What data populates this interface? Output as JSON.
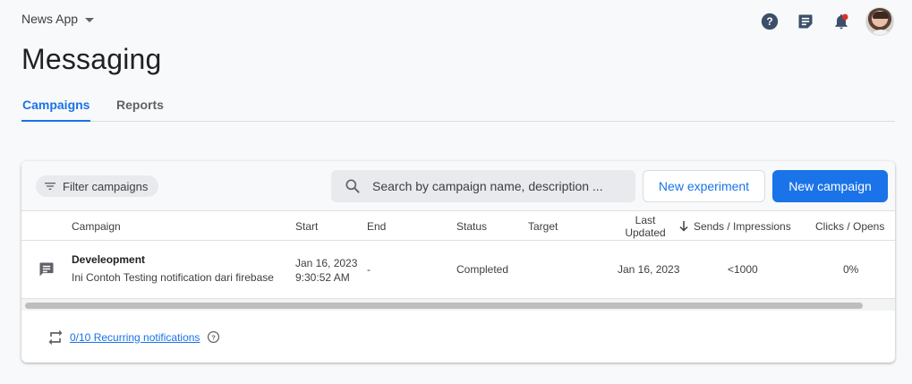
{
  "app": {
    "name": "News App"
  },
  "header": {
    "icons": [
      "help-icon",
      "feedback-icon",
      "notifications-icon",
      "avatar"
    ]
  },
  "page": {
    "title": "Messaging"
  },
  "tabs": [
    {
      "label": "Campaigns",
      "active": true
    },
    {
      "label": "Reports",
      "active": false
    }
  ],
  "toolbar": {
    "filter_label": "Filter campaigns",
    "search_placeholder": "Search by campaign name, description ...",
    "new_experiment_label": "New experiment",
    "new_campaign_label": "New campaign"
  },
  "table": {
    "columns": {
      "campaign": "Campaign",
      "start": "Start",
      "end": "End",
      "status": "Status",
      "target": "Target",
      "last_updated_line1": "Last",
      "last_updated_line2": "Updated",
      "sends": "Sends / Impressions",
      "clicks": "Clicks / Opens"
    },
    "rows": [
      {
        "name": "Develeopment",
        "description": "Ini Contoh Testing notification dari firebase",
        "start_date": "Jan 16, 2023",
        "start_time": "9:30:52 AM",
        "end": "-",
        "status": "Completed",
        "target": "",
        "last_updated": "Jan 16, 2023",
        "sends": "<1000",
        "clicks": "0%"
      }
    ]
  },
  "footer": {
    "recurring_label": "0/10 Recurring notifications"
  },
  "colors": {
    "accent": "#1a73e8",
    "background": "#f8f9fa",
    "notification_dot": "#d93025"
  }
}
